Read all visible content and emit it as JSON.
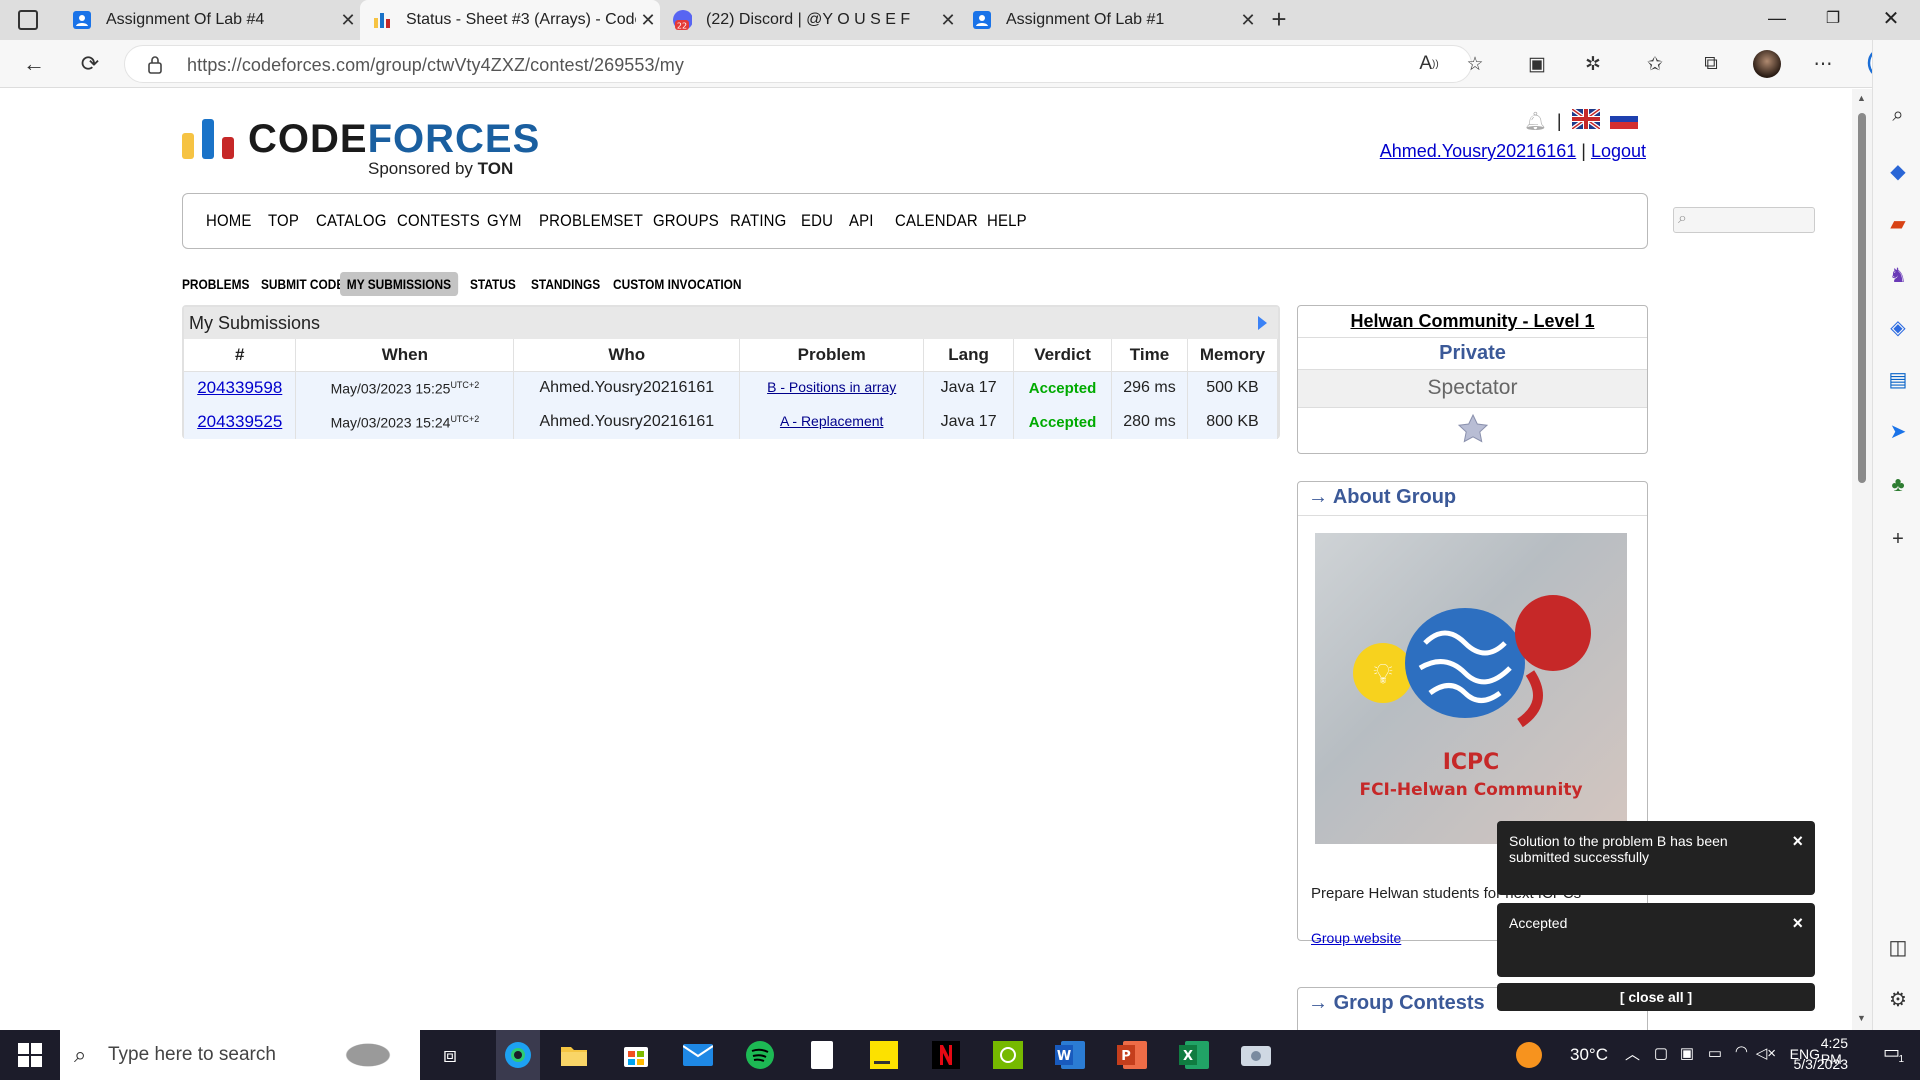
{
  "tabs": [
    {
      "title": "Assignment Of Lab #4",
      "icon": "person-icon"
    },
    {
      "title": "Status - Sheet #3 (Arrays) - Code",
      "icon": "codeforces-icon",
      "active": true
    },
    {
      "title": "(22) Discord | @Y O U S E F",
      "icon": "discord-icon",
      "badge": "22"
    },
    {
      "title": "Assignment Of Lab #1",
      "icon": "person-icon"
    }
  ],
  "address": {
    "url": "https://codeforces.com/group/ctwVty4ZXZ/contest/269553/my"
  },
  "site": {
    "brand_code": "CODE",
    "brand_forces": "FORCES",
    "sponsor_prefix": "Sponsored by ",
    "sponsor_name": "TON",
    "username": "Ahmed.Yousry20216161",
    "separator": " | ",
    "logout": "Logout",
    "lang_sep": "|"
  },
  "menu": [
    "HOME",
    "TOP",
    "CATALOG",
    "CONTESTS",
    "GYM",
    "PROBLEMSET",
    "GROUPS",
    "RATING",
    "EDU",
    "API",
    "CALENDAR",
    "HELP"
  ],
  "subnav": [
    "PROBLEMS",
    "SUBMIT CODE",
    "MY SUBMISSIONS",
    "STATUS",
    "STANDINGS",
    "CUSTOM INVOCATION"
  ],
  "submissions": {
    "title": "My Submissions",
    "columns": [
      "#",
      "When",
      "Who",
      "Problem",
      "Lang",
      "Verdict",
      "Time",
      "Memory"
    ],
    "rows": [
      {
        "id": "204339598",
        "when": "May/03/2023 15:25",
        "tz": "UTC+2",
        "who": "Ahmed.Yousry20216161",
        "problem": "B - Positions in array",
        "lang": "Java 17",
        "verdict": "Accepted",
        "time": "296 ms",
        "memory": "500 KB"
      },
      {
        "id": "204339525",
        "when": "May/03/2023 15:24",
        "tz": "UTC+2",
        "who": "Ahmed.Yousry20216161",
        "problem": "A - Replacement",
        "lang": "Java 17",
        "verdict": "Accepted",
        "time": "280 ms",
        "memory": "800 KB"
      }
    ]
  },
  "contest_box": {
    "name": "Helwan Community - Level 1",
    "access": "Private",
    "role": "Spectator"
  },
  "about": {
    "title": "About Group",
    "logo_line1": "ICPC",
    "logo_line2": "FCI-Helwan Community",
    "description": "Prepare Helwan students for next ICPCs",
    "site_link": "Group website"
  },
  "group_contests": {
    "title": "Group Contests"
  },
  "toasts": [
    {
      "text": "Solution to the problem B has been submitted successfully"
    },
    {
      "text": "Accepted"
    }
  ],
  "close_all": "[ close all ]",
  "taskbar": {
    "search_placeholder": "Type here to search",
    "weather": "30°C",
    "lang": "ENG",
    "time": "4:25 PM",
    "date": "5/3/2023",
    "notif_count": "1"
  },
  "colors": {
    "verdict_ok": "#00aa00",
    "link": "#0000cc",
    "accent": "#3b5998"
  }
}
